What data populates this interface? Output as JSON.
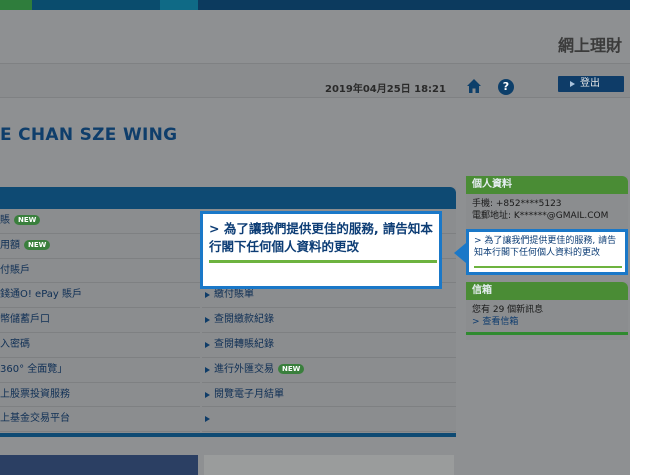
{
  "app_title": "網上理財",
  "datetime": "2019年04月25日 18:21",
  "logout_label": "登出",
  "user_name": "E CHAN SZE WING",
  "menu_left": [
    {
      "label": "賬",
      "badge": "NEW"
    },
    {
      "label": "用額",
      "badge": "NEW"
    },
    {
      "label": "付賬戶"
    },
    {
      "label": "錢通O! ePay 賬戶"
    },
    {
      "label": "幣儲蓄戶口"
    },
    {
      "label": "入密碼"
    },
    {
      "label": "360° 全面覽」"
    },
    {
      "label": "上股票投資服務"
    },
    {
      "label": "上基金交易平台"
    }
  ],
  "menu_right": [
    {
      "label": ""
    },
    {
      "label": ""
    },
    {
      "label": ""
    },
    {
      "label": "繳付賬單"
    },
    {
      "label": "查閱繳款紀錄"
    },
    {
      "label": "查閱轉賬紀錄"
    },
    {
      "label": "進行外匯交易",
      "badge": "NEW"
    },
    {
      "label": "閱覽電子月結單"
    },
    {
      "label": ""
    }
  ],
  "profile": {
    "title": "個人資料",
    "phone": "手機: +852****5123",
    "email": "電郵地址: K******@GMAIL.COM",
    "update_link": "> 為了讓我們提供更佳的服務, 請告知本行閣下任何個人資料的更改"
  },
  "inbox": {
    "title": "信箱",
    "message_count": "您有 29 個新訊息",
    "view_link": "> 查看信箱"
  },
  "tooltip_text": "> 為了讓我們提供更佳的服務, 請告知本行閣下任何個人資料的更改",
  "icons": [
    "home-icon",
    "help-icon"
  ]
}
